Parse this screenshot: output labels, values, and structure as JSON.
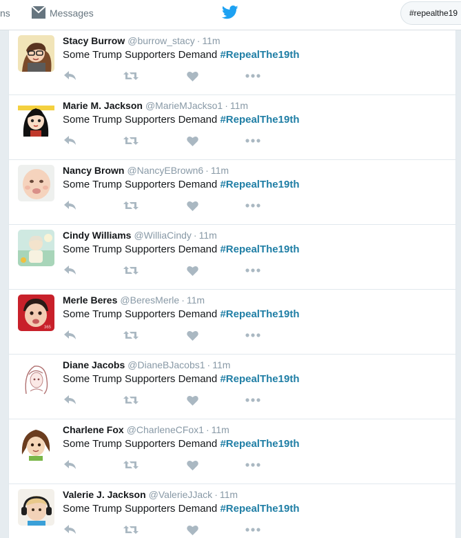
{
  "topbar": {
    "nav_left_fragment": "ns",
    "messages_label": "Messages",
    "search_value": "#repealthe19"
  },
  "colors": {
    "hashtag": "#1f7ea5",
    "twitter_blue": "#1da1f2",
    "icon_gray": "#aab8c2"
  },
  "tweets": [
    {
      "name": "Stacy Burrow",
      "handle": "@burrow_stacy",
      "time": "11m",
      "text": "Some Trump Supporters Demand ",
      "hashtag": "#RepealThe19th",
      "avatar": "cartoon-girl-glasses"
    },
    {
      "name": "Marie M. Jackson",
      "handle": "@MarieMJackso1",
      "time": "11m",
      "text": "Some Trump Supporters Demand ",
      "hashtag": "#RepealThe19th",
      "avatar": "cartoon-girl-dark-hair"
    },
    {
      "name": "Nancy Brown",
      "handle": "@NancyEBrown6",
      "time": "11m",
      "text": "Some Trump Supporters Demand ",
      "hashtag": "#RepealThe19th",
      "avatar": "baby-photo"
    },
    {
      "name": "Cindy Williams",
      "handle": "@WilliaCindy",
      "time": "11m",
      "text": "Some Trump Supporters Demand ",
      "hashtag": "#RepealThe19th",
      "avatar": "child-photo"
    },
    {
      "name": "Merle Beres",
      "handle": "@BeresMerle",
      "time": "11m",
      "text": "Some Trump Supporters Demand ",
      "hashtag": "#RepealThe19th",
      "avatar": "baby-red-background"
    },
    {
      "name": "Diane Jacobs",
      "handle": "@DianeBJacobs1",
      "time": "11m",
      "text": "Some Trump Supporters Demand ",
      "hashtag": "#RepealThe19th",
      "avatar": "anime-sketch-girl"
    },
    {
      "name": "Charlene Fox",
      "handle": "@CharleneCFox1",
      "time": "11m",
      "text": "Some Trump Supporters Demand ",
      "hashtag": "#RepealThe19th",
      "avatar": "cartoon-girl-brown-hair"
    },
    {
      "name": "Valerie J. Jackson",
      "handle": "@ValerieJJack",
      "time": "11m",
      "text": "Some Trump Supporters Demand ",
      "hashtag": "#RepealThe19th",
      "avatar": "baby-headphones"
    }
  ]
}
